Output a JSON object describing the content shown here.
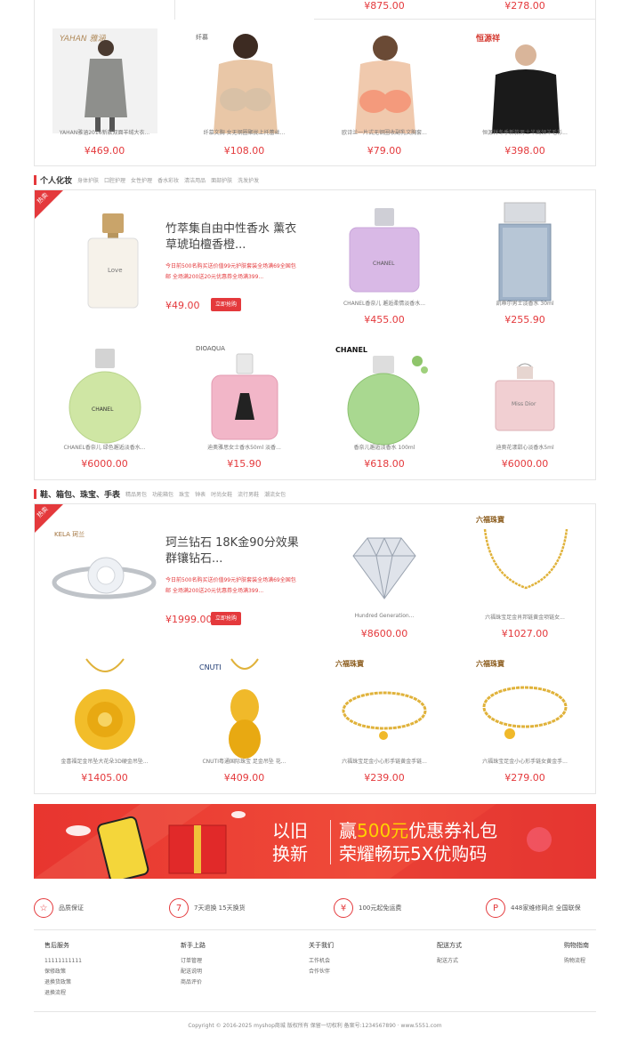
{
  "top_row": {
    "prices_above": [
      "¥875.00",
      "¥278.00"
    ],
    "items": [
      {
        "name": "YAHAN雅涵2016新款双面羊绒大衣...",
        "price": "¥469.00",
        "brand": "YAHAN 雅涵"
      },
      {
        "name": "纤慕文胸 女无钢圈聚拢上托蕾丝...",
        "price": "¥108.00",
        "brand": "纤慕"
      },
      {
        "name": "欧诗兰一片式无钢圈收副乳文胸套...",
        "price": "¥79.00",
        "brand": ""
      },
      {
        "name": "恒源祥冬季新款男士半高领羊毛衫...",
        "price": "¥398.00",
        "brand": "恒源祥"
      }
    ]
  },
  "section1": {
    "title": "个人化妆",
    "subs": [
      "身体护肤",
      "口腔护理",
      "女性护理",
      "香水彩妆",
      "清洁用品",
      "面部护肤",
      "洗发护发"
    ],
    "hot_label": "热卖",
    "featured": {
      "title": "竹萃集自由中性香水 薰衣草琥珀檀香橙...",
      "promo": "今日前500名购买送价值99元护肤套装全场满69全国包邮 全场满200送20元优惠券全场满399...",
      "price": "¥49.00",
      "buy_label": "立即抢购",
      "bottle_label": "Love"
    },
    "items": [
      {
        "name": "CHANEL香奈儿 邂逅柔情淡香水...",
        "price": "¥455.00",
        "brand": "CHANEL"
      },
      {
        "name": "凯蒂尔男士淡香水 30ml",
        "price": "¥255.90",
        "brand": ""
      },
      {
        "name": "CHANEL香奈儿 绿色邂逅淡香水...",
        "price": "¥6000.00",
        "brand": "CHANEL"
      },
      {
        "name": "迪奥雅思女士香水50ml 淡香...",
        "price": "¥15.90",
        "brand": "DIOAQUA"
      },
      {
        "name": "香奈儿邂逅淡香水 100ml",
        "price": "¥618.00",
        "brand": "CHANEL"
      },
      {
        "name": "迪奥花漾甜心淡香水5ml",
        "price": "¥6000.00",
        "brand": "Miss Dior"
      }
    ]
  },
  "section2": {
    "title": "鞋、箱包、珠宝、手表",
    "subs": [
      "精品男包",
      "功能箱包",
      "珠宝",
      "钟表",
      "时尚女鞋",
      "流行男鞋",
      "潮流女包"
    ],
    "hot_label": "热卖",
    "featured": {
      "title": "珂兰钻石 18K金90分效果群镶钻石...",
      "promo": "今日前500名购买送价值99元护肤套装全场满69全国包邮 全场满200送20元优惠券全场满399...",
      "price": "¥1999.00",
      "buy_label": "立即抢购",
      "brand": "KELA 珂兰"
    },
    "items": [
      {
        "name": "Hundred Generation...",
        "price": "¥8600.00",
        "brand": ""
      },
      {
        "name": "六福珠宝足金肖邦链黄金项链女...",
        "price": "¥1027.00",
        "brand": "六福珠寶"
      },
      {
        "name": "金喜福足金吊坠大花朵3D硬金吊坠...",
        "price": "¥1405.00",
        "brand": ""
      },
      {
        "name": "CNUTI粤通国际珠宝 足金吊坠 花...",
        "price": "¥409.00",
        "brand": "CNUTI"
      },
      {
        "name": "六福珠宝足金小心形手链黄金手链...",
        "price": "¥239.00",
        "brand": "六福珠寶"
      },
      {
        "name": "六福珠宝足金小心形手链女黄金手...",
        "price": "¥279.00",
        "brand": "六福珠寶"
      }
    ]
  },
  "banner": {
    "left_line1": "以旧",
    "left_line2": "换新",
    "right_line1_a": "赢",
    "right_line1_b": "500元",
    "right_line1_c": "优惠券礼包",
    "right_line2": "荣耀畅玩5X优购码"
  },
  "services": [
    {
      "icon": "quality-star-icon",
      "glyph": "☆",
      "label": "品质保证"
    },
    {
      "icon": "seven-days-icon",
      "glyph": "7",
      "label": "7天退换 15天换货"
    },
    {
      "icon": "free-shipping-icon",
      "glyph": "¥",
      "label": "100元起免运费"
    },
    {
      "icon": "repair-point-icon",
      "glyph": "P",
      "label": "448家维修网点 全国联保"
    }
  ],
  "footer": {
    "columns": [
      {
        "heading": "售后服务",
        "links": [
          "11111111111",
          "保修政策",
          "退换货政策",
          "退换流程"
        ]
      },
      {
        "heading": "新手上路",
        "links": [
          "订单管理",
          "配送说明",
          "商品评价"
        ]
      },
      {
        "heading": "关于我们",
        "links": [
          "工作机会",
          "合作伙伴"
        ]
      },
      {
        "heading": "配送方式",
        "links": [
          "配送方式"
        ]
      },
      {
        "heading": "购物指南",
        "links": [
          "购物流程"
        ]
      }
    ],
    "copyright": "Copyright © 2016-2025 myshop商城 版权所有 保留一切权利 备案号:1234567890 · www.5551.com"
  },
  "colors": {
    "accent": "#e4393c",
    "banner_bg": "#ef4b3a",
    "banner_highlight": "#ffd200"
  }
}
